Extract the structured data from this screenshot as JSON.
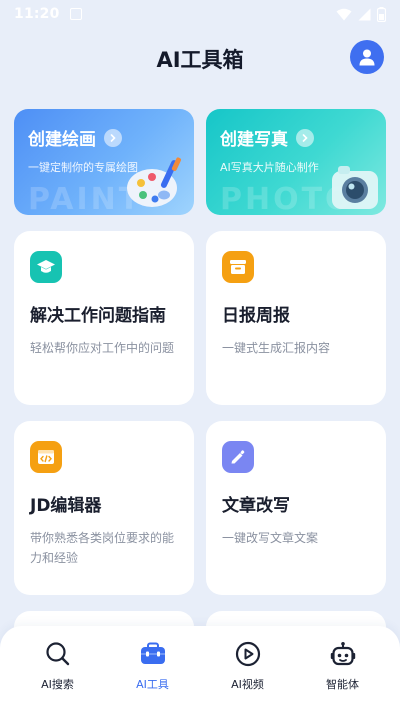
{
  "status_bar": {
    "time": "11:20"
  },
  "header": {
    "title": "AI工具箱"
  },
  "heroes": [
    {
      "title": "创建绘画",
      "subtitle": "一键定制你的专属绘图",
      "watermark": "PAINT"
    },
    {
      "title": "创建写真",
      "subtitle": "AI写真大片随心制作",
      "watermark": "PHOTO"
    }
  ],
  "tools": [
    {
      "title": "解决工作问题指南",
      "desc": "轻松帮你应对工作中的问题",
      "icon": "graduation-cap-icon",
      "color": "#17c3b2"
    },
    {
      "title": "日报周报",
      "desc": "一键式生成汇报内容",
      "icon": "report-box-icon",
      "color": "#f5a012"
    },
    {
      "title": "JD编辑器",
      "desc": "带你熟悉各类岗位要求的能力和经验",
      "icon": "code-window-icon",
      "color": "#f5a012"
    },
    {
      "title": "文章改写",
      "desc": "一键改写文章文案",
      "icon": "pen-icon",
      "color": "#7a86f2"
    }
  ],
  "nav": {
    "items": [
      {
        "label": "AI搜索",
        "icon": "search-icon"
      },
      {
        "label": "AI工具",
        "icon": "toolbox-icon",
        "active": true
      },
      {
        "label": "AI视频",
        "icon": "play-circle-icon"
      },
      {
        "label": "智能体",
        "icon": "robot-icon"
      }
    ]
  },
  "colors": {
    "accent": "#3a6df0",
    "page_bg": "#e8eef9",
    "paint_hero": "#4e8ff5",
    "photo_hero": "#16c6c8"
  }
}
